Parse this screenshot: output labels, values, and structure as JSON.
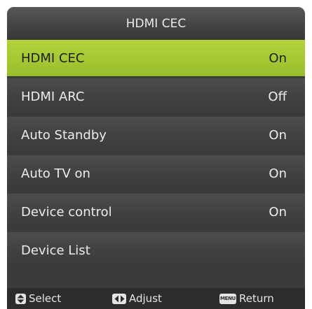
{
  "menu": {
    "title": "HDMI CEC",
    "items": [
      {
        "label": "HDMI CEC",
        "value": "On"
      },
      {
        "label": "HDMI ARC",
        "value": "Off"
      },
      {
        "label": "Auto Standby",
        "value": "On"
      },
      {
        "label": "Auto TV on",
        "value": "On"
      },
      {
        "label": "Device control",
        "value": "On"
      },
      {
        "label": "Device List",
        "value": ""
      }
    ],
    "selected_index": 0
  },
  "footer": {
    "select_label": "Select",
    "adjust_label": "Adjust",
    "return_label": "Return",
    "menu_key_label": "MENU",
    "select_icon": "up-down-arrow-icon",
    "adjust_icon": "left-right-arrow-icon",
    "return_icon": "menu-key-icon"
  },
  "colors": {
    "highlight": "#a6c933",
    "panel": "#3b3b3b",
    "footer": "#2c2c2c"
  }
}
